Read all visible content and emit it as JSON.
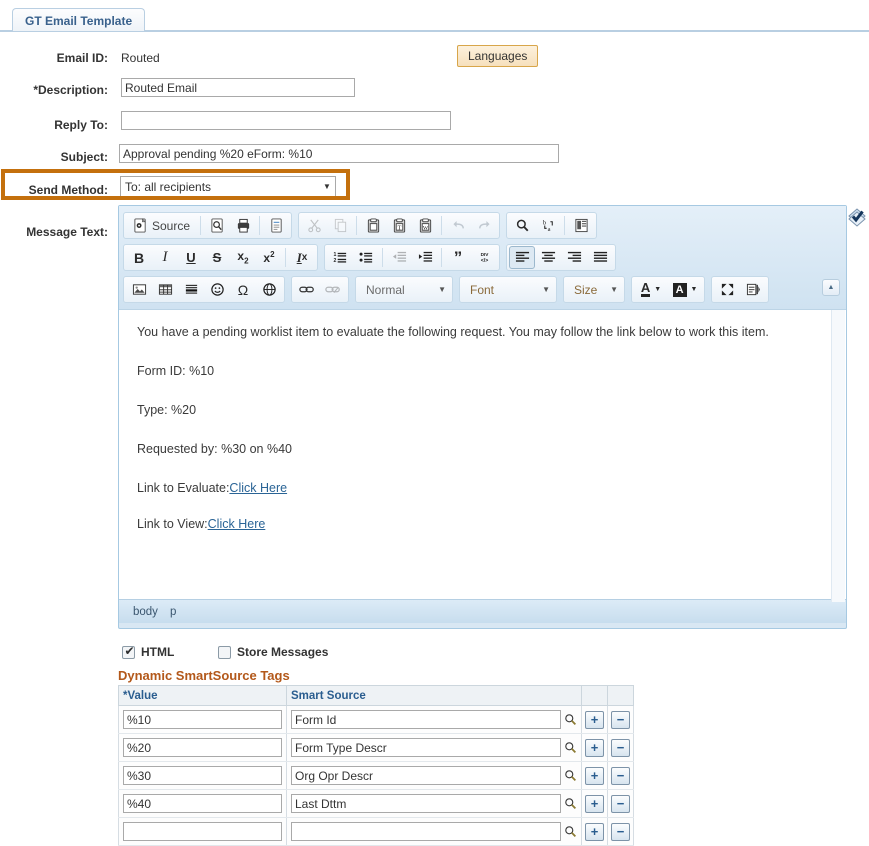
{
  "tab": {
    "label": "GT Email Template"
  },
  "form": {
    "email_id": {
      "label": "Email ID:",
      "value": "Routed"
    },
    "description": {
      "label": "*Description:",
      "value": "Routed Email",
      "placeholder": ""
    },
    "reply_to": {
      "label": "Reply To:",
      "value": "",
      "placeholder": ""
    },
    "subject": {
      "label": "Subject:",
      "value": "Approval pending %20 eForm: %10",
      "placeholder": ""
    },
    "send_method": {
      "label": "Send Method:",
      "value": "To: all recipients",
      "options": [
        "To: all recipients"
      ],
      "highlight_color": "#c4700d"
    },
    "message_text": {
      "label": "Message Text:"
    },
    "languages_button": {
      "label": "Languages"
    }
  },
  "editor": {
    "toolbar": {
      "row1": [
        {
          "group": [
            {
              "name": "source-button",
              "label": "Source",
              "icon": "source-icon",
              "disabled": false
            },
            {
              "name": "preview-button",
              "label": "",
              "icon": "preview-icon",
              "disabled": false
            },
            {
              "name": "print-button",
              "label": "",
              "icon": "print-icon",
              "disabled": false
            },
            {
              "name": "templates-button",
              "label": "",
              "icon": "templates-icon",
              "disabled": false
            }
          ]
        },
        {
          "group": [
            {
              "name": "cut-button",
              "label": "",
              "icon": "scissors-icon",
              "disabled": true
            },
            {
              "name": "copy-button",
              "label": "",
              "icon": "copy-icon",
              "disabled": true
            },
            {
              "name": "paste-button",
              "label": "",
              "icon": "paste-icon",
              "disabled": false
            },
            {
              "name": "paste-text-button",
              "label": "",
              "icon": "paste-text-icon",
              "disabled": false
            },
            {
              "name": "paste-word-button",
              "label": "",
              "icon": "paste-word-icon",
              "disabled": false
            },
            {
              "name": "undo-button",
              "label": "",
              "icon": "undo-arrow-icon",
              "disabled": true
            },
            {
              "name": "redo-button",
              "label": "",
              "icon": "redo-arrow-icon",
              "disabled": true
            }
          ]
        },
        {
          "group": [
            {
              "name": "find-button",
              "label": "",
              "icon": "magnifier-icon",
              "disabled": false
            },
            {
              "name": "replace-button",
              "label": "",
              "icon": "replace-icon",
              "disabled": false
            },
            {
              "name": "select-all-button",
              "label": "",
              "icon": "select-all-icon",
              "disabled": false
            }
          ]
        }
      ],
      "row2": [
        {
          "group": [
            {
              "name": "bold-button",
              "label": "B",
              "icon": "bold-icon",
              "disabled": false
            },
            {
              "name": "italic-button",
              "label": "I",
              "icon": "italic-icon",
              "disabled": false
            },
            {
              "name": "underline-button",
              "label": "U",
              "icon": "underline-icon",
              "disabled": false
            },
            {
              "name": "strike-button",
              "label": "S",
              "icon": "strikethrough-icon",
              "disabled": false
            },
            {
              "name": "subscript-button",
              "label": "x₂",
              "icon": "subscript-icon",
              "disabled": false
            },
            {
              "name": "superscript-button",
              "label": "x²",
              "icon": "superscript-icon",
              "disabled": false
            },
            {
              "name": "remove-format-button",
              "label": "Ix",
              "icon": "remove-format-icon",
              "disabled": false
            }
          ]
        },
        {
          "group": [
            {
              "name": "numbered-list-button",
              "label": "",
              "icon": "numbered-list-icon",
              "disabled": false
            },
            {
              "name": "bulleted-list-button",
              "label": "",
              "icon": "bulleted-list-icon",
              "disabled": false
            },
            {
              "name": "outdent-button",
              "label": "",
              "icon": "outdent-icon",
              "disabled": true
            },
            {
              "name": "indent-button",
              "label": "",
              "icon": "indent-icon",
              "disabled": false
            },
            {
              "name": "blockquote-button",
              "label": "",
              "icon": "blockquote-icon",
              "disabled": false
            },
            {
              "name": "div-container-button",
              "label": "",
              "icon": "div-container-icon",
              "disabled": false
            }
          ]
        },
        {
          "group": [
            {
              "name": "align-left-button",
              "label": "",
              "icon": "align-left-icon",
              "active": true
            },
            {
              "name": "align-center-button",
              "label": "",
              "icon": "align-center-icon",
              "active": false
            },
            {
              "name": "align-right-button",
              "label": "",
              "icon": "align-right-icon",
              "active": false
            },
            {
              "name": "align-justify-button",
              "label": "",
              "icon": "align-justify-icon",
              "active": false
            }
          ]
        }
      ],
      "row3": [
        {
          "group": [
            {
              "name": "image-button",
              "label": "",
              "icon": "image-icon",
              "disabled": false
            },
            {
              "name": "table-button",
              "label": "",
              "icon": "table-icon",
              "disabled": false
            },
            {
              "name": "horizontal-rule-button",
              "label": "",
              "icon": "horizontal-rule-icon",
              "disabled": false
            },
            {
              "name": "smiley-button",
              "label": "",
              "icon": "smiley-icon",
              "disabled": false
            },
            {
              "name": "special-char-button",
              "label": "Ω",
              "icon": "omega-icon",
              "disabled": false
            },
            {
              "name": "iframe-button",
              "label": "",
              "icon": "globe-icon",
              "disabled": false
            }
          ]
        },
        {
          "group": [
            {
              "name": "link-button",
              "label": "",
              "icon": "link-icon",
              "disabled": false
            },
            {
              "name": "unlink-button",
              "label": "",
              "icon": "unlink-icon",
              "disabled": true
            }
          ]
        }
      ],
      "paragraph_format": {
        "name": "paragraph-format-select",
        "value": "Normal"
      },
      "font_family": {
        "name": "font-family-select",
        "value": "Font"
      },
      "font_size": {
        "name": "font-size-select",
        "value": "Size"
      },
      "text_color": {
        "name": "text-color-button",
        "label": "A"
      },
      "bg_color": {
        "name": "background-color-button",
        "label": "A"
      },
      "maximize": {
        "name": "maximize-button",
        "icon": "maximize-icon"
      },
      "show_blocks": {
        "name": "show-blocks-button",
        "icon": "show-blocks-icon"
      },
      "collapse": {
        "name": "collapse-toolbar-button",
        "icon": "chevron-up-icon"
      },
      "spellcheck": {
        "name": "spellcheck-icon"
      }
    },
    "body_paragraphs": [
      {
        "id": "intro",
        "text": "You have a pending worklist item to evaluate the following request. You may follow the link below to work this item."
      },
      {
        "id": "form-id",
        "text": "Form ID: %10"
      },
      {
        "id": "type",
        "text": "Type: %20"
      },
      {
        "id": "requested-by",
        "text": "Requested by: %30 on %40"
      }
    ],
    "link_lines": [
      {
        "id": "evaluate",
        "prefix": "Link to Evaluate:",
        "link": "Click Here"
      },
      {
        "id": "view",
        "prefix": "Link to View:",
        "link": "Click Here"
      }
    ],
    "statusbar": {
      "path": [
        "body",
        "p"
      ]
    }
  },
  "options": {
    "html": {
      "label": "HTML",
      "checked": true
    },
    "store_messages": {
      "label": "Store Messages",
      "checked": false
    }
  },
  "grid": {
    "title": "Dynamic SmartSource Tags",
    "columns": [
      "*Value",
      "Smart Source",
      "",
      ""
    ],
    "add_label": "+",
    "remove_label": "−",
    "rows": [
      {
        "value": "%10",
        "smart_source": "Form Id"
      },
      {
        "value": "%20",
        "smart_source": "Form Type Descr"
      },
      {
        "value": "%30",
        "smart_source": "Org Opr Descr"
      },
      {
        "value": "%40",
        "smart_source": "Last Dttm"
      },
      {
        "value": "",
        "smart_source": ""
      }
    ]
  }
}
